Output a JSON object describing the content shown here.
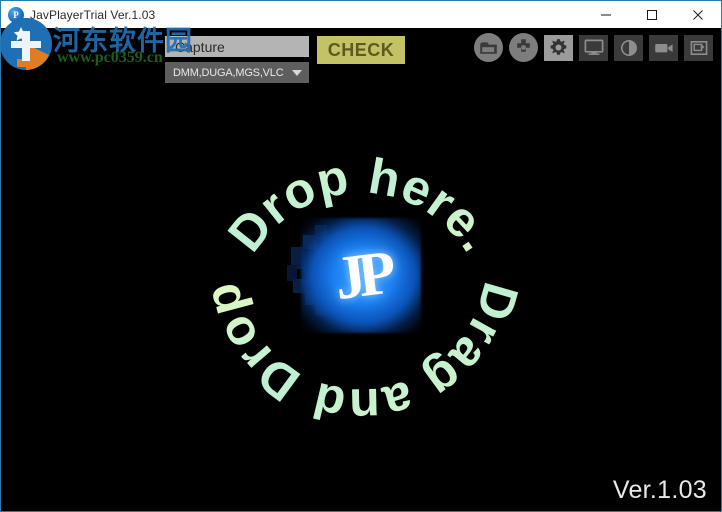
{
  "window": {
    "title": "JavPlayerTrial Ver.1.03",
    "app_icon": "jp-app-icon",
    "controls": {
      "minimize": "minimize-icon",
      "maximize": "maximize-icon",
      "close": "close-icon"
    }
  },
  "toolbar": {
    "capture_label": "Capture",
    "source_value": "DMM,DUGA,MGS,VLC",
    "caret_icon": "chevron-down-icon",
    "check_label": "CHECK",
    "icons": [
      {
        "name": "folder-icon",
        "shape": "round"
      },
      {
        "name": "dpad-icon",
        "shape": "round"
      },
      {
        "name": "gear-icon",
        "shape": "square",
        "active": true
      },
      {
        "name": "monitor-icon",
        "shape": "square",
        "active": false
      },
      {
        "name": "contrast-icon",
        "shape": "square",
        "active": false
      },
      {
        "name": "video-camera-icon",
        "shape": "square",
        "active": false
      },
      {
        "name": "add-frame-icon",
        "shape": "square",
        "active": false
      }
    ]
  },
  "drop_zone": {
    "ring_text_top": "Drop here.",
    "ring_text_bottom": "Drag and Drop",
    "ring_text_full": "Drop here. Drag and Drop",
    "logo_text": "JP",
    "ring_color": "#d8f5c0",
    "glow_color": "#1b7ff0"
  },
  "footer": {
    "version": "Ver.1.03"
  },
  "watermark": {
    "site_name": "河东软件园",
    "url": "www.pc0359.cn",
    "logo": "hedong-logo-icon"
  },
  "colors": {
    "title_bar_bg": "#ffffff",
    "canvas_bg": "#000000",
    "check_button": "#c3c267",
    "check_text": "#5d5b1c",
    "capture_field": "#b4b4b4",
    "select_field": "#5e5e5e",
    "window_border": "#2a7ab0"
  }
}
